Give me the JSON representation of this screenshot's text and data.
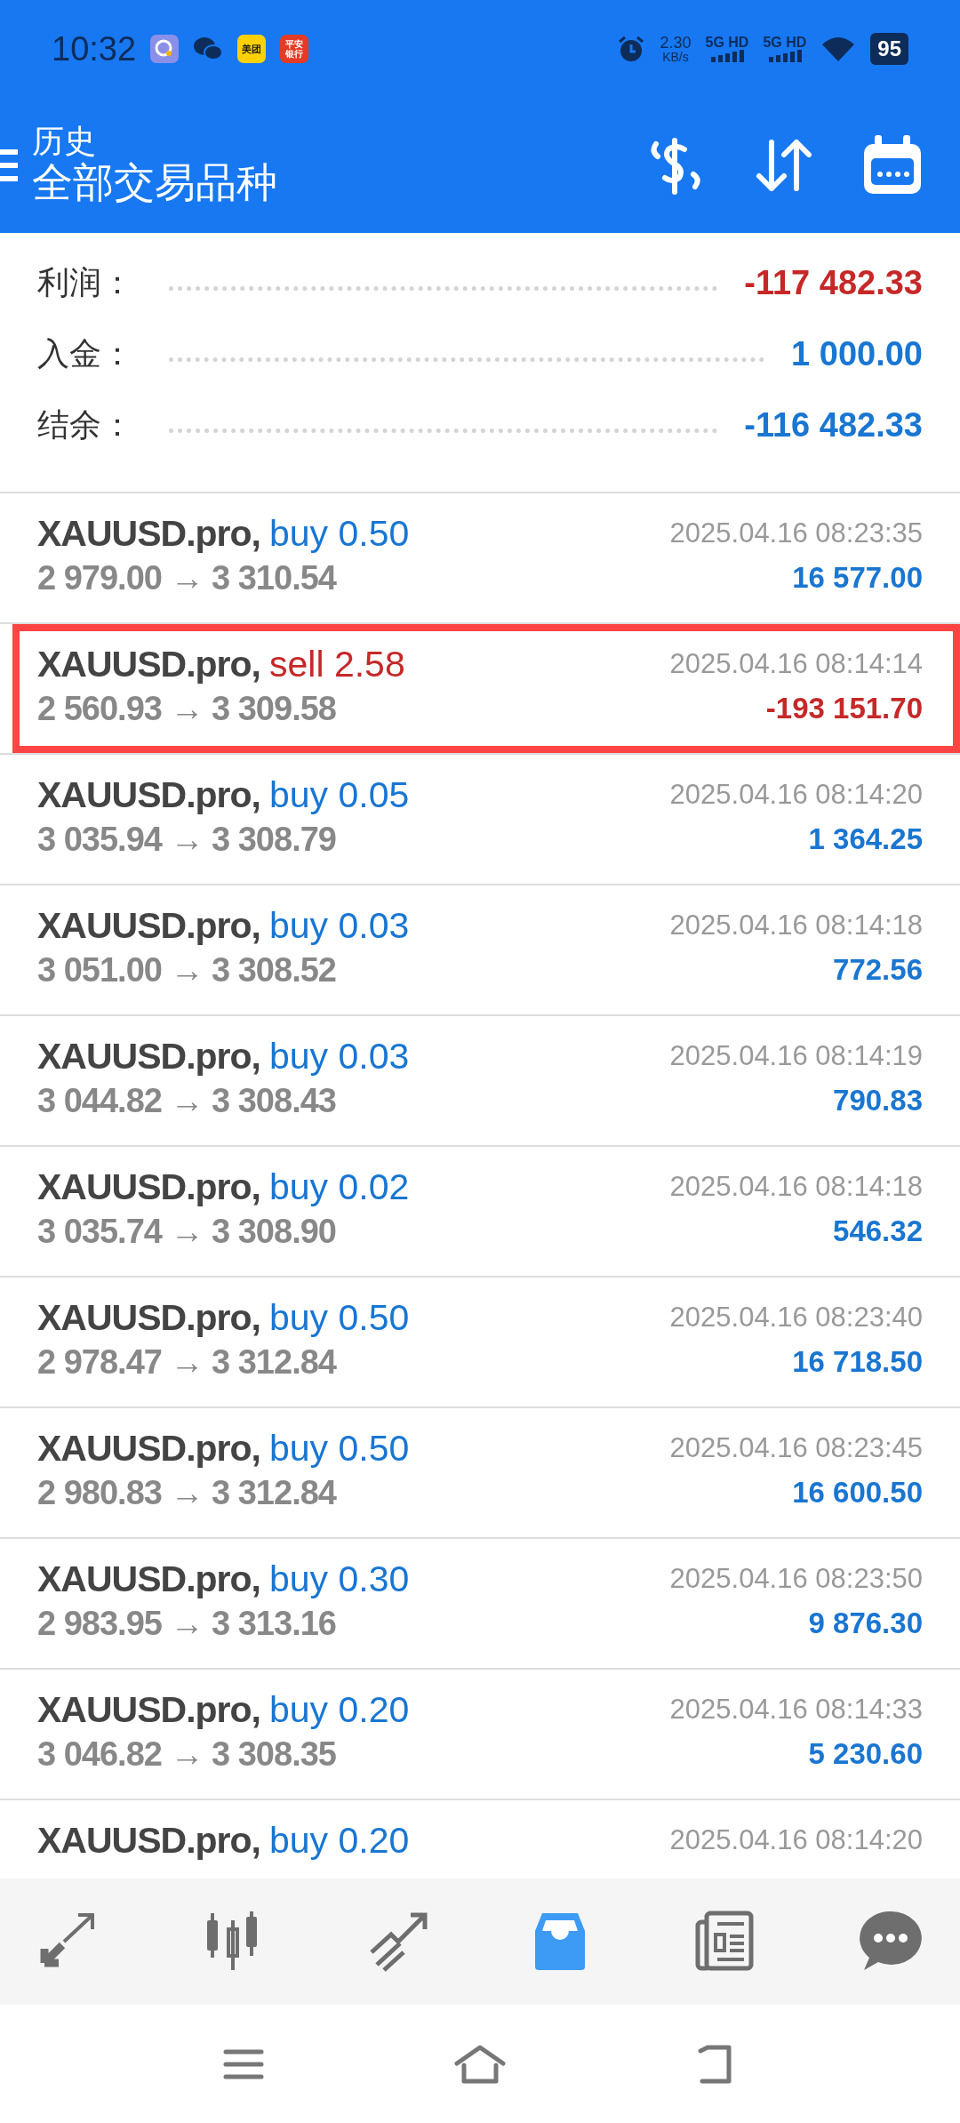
{
  "status_bar": {
    "time": "10:32",
    "app_badges": [
      "美团",
      "平安银行"
    ],
    "net_speed": "2.30",
    "net_unit": "KB/s",
    "sims": [
      "5G HD",
      "5G HD"
    ],
    "battery": "95"
  },
  "header": {
    "title": "历史",
    "subtitle": "全部交易品种"
  },
  "summary": [
    {
      "label": "利润：",
      "value": "-117 482.33",
      "color": "#c62828"
    },
    {
      "label": "入金：",
      "value": "1 000.00",
      "color": "#1976d2"
    },
    {
      "label": "结余：",
      "value": "-116 482.33",
      "color": "#1976d2"
    }
  ],
  "deals": [
    {
      "symbol": "XAUUSD.pro,",
      "kind": "buy",
      "action": "buy 0.50",
      "time": "2025.04.16 08:23:35",
      "prices": "2 979.00 → 3 310.54",
      "profit": "16 577.00",
      "highlighted": false
    },
    {
      "symbol": "XAUUSD.pro,",
      "kind": "sell",
      "action": "sell 2.58",
      "time": "2025.04.16 08:14:14",
      "prices": "2 560.93 → 3 309.58",
      "profit": "-193 151.70",
      "highlighted": true
    },
    {
      "symbol": "XAUUSD.pro,",
      "kind": "buy",
      "action": "buy 0.05",
      "time": "2025.04.16 08:14:20",
      "prices": "3 035.94 → 3 308.79",
      "profit": "1 364.25",
      "highlighted": false
    },
    {
      "symbol": "XAUUSD.pro,",
      "kind": "buy",
      "action": "buy 0.03",
      "time": "2025.04.16 08:14:18",
      "prices": "3 051.00 → 3 308.52",
      "profit": "772.56",
      "highlighted": false
    },
    {
      "symbol": "XAUUSD.pro,",
      "kind": "buy",
      "action": "buy 0.03",
      "time": "2025.04.16 08:14:19",
      "prices": "3 044.82 → 3 308.43",
      "profit": "790.83",
      "highlighted": false
    },
    {
      "symbol": "XAUUSD.pro,",
      "kind": "buy",
      "action": "buy 0.02",
      "time": "2025.04.16 08:14:18",
      "prices": "3 035.74 → 3 308.90",
      "profit": "546.32",
      "highlighted": false
    },
    {
      "symbol": "XAUUSD.pro,",
      "kind": "buy",
      "action": "buy 0.50",
      "time": "2025.04.16 08:23:40",
      "prices": "2 978.47 → 3 312.84",
      "profit": "16 718.50",
      "highlighted": false
    },
    {
      "symbol": "XAUUSD.pro,",
      "kind": "buy",
      "action": "buy 0.50",
      "time": "2025.04.16 08:23:45",
      "prices": "2 980.83 → 3 312.84",
      "profit": "16 600.50",
      "highlighted": false
    },
    {
      "symbol": "XAUUSD.pro,",
      "kind": "buy",
      "action": "buy 0.30",
      "time": "2025.04.16 08:23:50",
      "prices": "2 983.95 → 3 313.16",
      "profit": "9 876.30",
      "highlighted": false
    },
    {
      "symbol": "XAUUSD.pro,",
      "kind": "buy",
      "action": "buy 0.20",
      "time": "2025.04.16 08:14:33",
      "prices": "3 046.82 → 3 308.35",
      "profit": "5 230.60",
      "highlighted": false
    },
    {
      "symbol": "XAUUSD.pro,",
      "kind": "buy",
      "action": "buy 0.20",
      "time": "2025.04.16 08:14:20",
      "highlighted": false
    }
  ],
  "bottom_nav": [
    {
      "selected": false
    },
    {
      "selected": false
    },
    {
      "selected": false
    },
    {
      "selected": true
    },
    {
      "selected": false
    },
    {
      "selected": false
    }
  ]
}
